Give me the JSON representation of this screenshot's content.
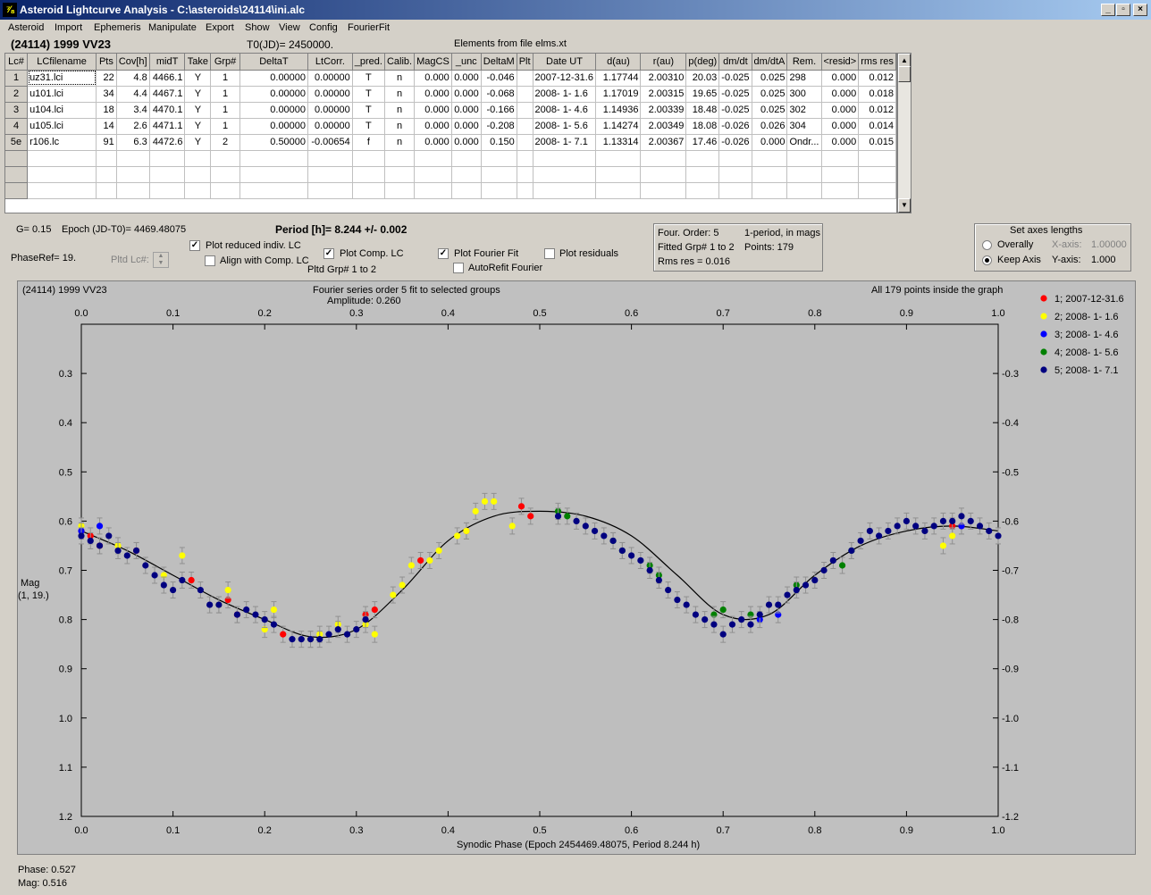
{
  "window": {
    "title": "Asteroid Lightcurve Analysis - C:\\asteroids\\24114\\ini.alc"
  },
  "menu": [
    "Asteroid",
    "Import",
    "Ephemeris",
    "Manipulate",
    "Export",
    "Show",
    "View",
    "Config",
    "FourierFit"
  ],
  "header": {
    "object": "(24114) 1999 VV23",
    "t0": "T0(JD)= 2450000.",
    "elements": "Elements from file elms.xt"
  },
  "table": {
    "columns": [
      "Lc#",
      "LCfilename",
      "Pts",
      "Cov[h]",
      "midT",
      "Take",
      "Grp#",
      "DeltaT",
      "LtCorr.",
      "_pred.",
      "Calib.",
      "MagCS",
      "_unc",
      "DeltaM",
      "Plt",
      "Date UT",
      "d(au)",
      "r(au)",
      "p(deg)",
      "dm/dt",
      "dm/dtA",
      "Rem.",
      "<resid>",
      "rms res"
    ],
    "rows": [
      [
        "1",
        "uz31.lci",
        "22",
        "4.8",
        "4466.1",
        "Y",
        "1",
        "0.00000",
        "0.00000",
        "T",
        "n",
        "0.000",
        "0.000",
        "-0.046",
        "",
        "2007-12-31.6",
        "1.17744",
        "2.00310",
        "20.03",
        "-0.025",
        "0.025",
        "298",
        "0.000",
        "0.012"
      ],
      [
        "2",
        "u101.lci",
        "34",
        "4.4",
        "4467.1",
        "Y",
        "1",
        "0.00000",
        "0.00000",
        "T",
        "n",
        "0.000",
        "0.000",
        "-0.068",
        "",
        "2008- 1- 1.6",
        "1.17019",
        "2.00315",
        "19.65",
        "-0.025",
        "0.025",
        "300",
        "0.000",
        "0.018"
      ],
      [
        "3",
        "u104.lci",
        "18",
        "3.4",
        "4470.1",
        "Y",
        "1",
        "0.00000",
        "0.00000",
        "T",
        "n",
        "0.000",
        "0.000",
        "-0.166",
        "",
        "2008- 1- 4.6",
        "1.14936",
        "2.00339",
        "18.48",
        "-0.025",
        "0.025",
        "302",
        "0.000",
        "0.012"
      ],
      [
        "4",
        "u105.lci",
        "14",
        "2.6",
        "4471.1",
        "Y",
        "1",
        "0.00000",
        "0.00000",
        "T",
        "n",
        "0.000",
        "0.000",
        "-0.208",
        "",
        "2008- 1- 5.6",
        "1.14274",
        "2.00349",
        "18.08",
        "-0.026",
        "0.026",
        "304",
        "0.000",
        "0.014"
      ],
      [
        "5e",
        "r106.lc",
        "91",
        "6.3",
        "4472.6",
        "Y",
        "2",
        "0.50000",
        "-0.00654",
        "f",
        "n",
        "0.000",
        "0.000",
        "0.150",
        "",
        "2008- 1- 7.1",
        "1.13314",
        "2.00367",
        "17.46",
        "-0.026",
        "0.000",
        "Ondr...",
        "0.000",
        "0.015"
      ]
    ]
  },
  "controls": {
    "g": "G= 0.15",
    "epoch": "Epoch (JD-T0)= 4469.48075",
    "period": "Period [h]= 8.244 +/- 0.002",
    "phaseref": "PhaseRef= 19.",
    "pltd_lc": "Pltd Lc#:",
    "plot_reduced": "Plot reduced indiv. LC",
    "align_comp": "Align with Comp. LC",
    "plot_comp": "Plot Comp. LC",
    "pltd_grp": "Pltd Grp#  1   to   2",
    "plot_fourier": "Plot Fourier Fit",
    "autorefit": "AutoRefit Fourier",
    "plot_resid": "Plot residuals",
    "four_order": "Four. Order:  5",
    "one_period": "1-period, in mags",
    "fitted_grp": "Fitted Grp# 1 to 2",
    "points": "Points: 179",
    "rms_res": "Rms res     = 0.016",
    "axes_title": "Set axes lengths",
    "overally": "Overally",
    "keep_axis": "Keep Axis",
    "x_axis_lbl": "X-axis:",
    "x_axis_val": "1.00000",
    "y_axis_lbl": "Y-axis:",
    "y_axis_val": "1.000"
  },
  "plot": {
    "corner_title": "(24114) 1999 VV23",
    "fit_title": "Fourier series order 5 fit to selected groups",
    "amplitude": "Amplitude: 0.260",
    "inside": "All 179 points inside the graph",
    "ylabel": "Mag",
    "ylabel2": "(1, 19.)",
    "xlabel": "Synodic Phase (Epoch 2454469.48075, Period 8.244 h)"
  },
  "status": {
    "phase": "Phase:  0.527",
    "mag": "Mag:    0.516"
  },
  "chart_data": {
    "type": "scatter",
    "title": "Fourier series order 5 fit to selected groups",
    "xlabel": "Synodic Phase (Epoch 2454469.48075, Period 8.244 h)",
    "ylabel": "Mag",
    "xlim": [
      0.0,
      1.0
    ],
    "ylim": [
      1.2,
      0.2
    ],
    "x_ticks": [
      "0.0",
      "0.1",
      "0.2",
      "0.3",
      "0.4",
      "0.5",
      "0.6",
      "0.7",
      "0.8",
      "0.9",
      "1.0"
    ],
    "y_ticks": [
      "0.3",
      "0.4",
      "0.5",
      "0.6",
      "0.7",
      "0.8",
      "0.9",
      "1.0",
      "1.1",
      "1.2"
    ],
    "fourier_fit": {
      "x": [
        0.0,
        0.05,
        0.1,
        0.15,
        0.2,
        0.25,
        0.3,
        0.35,
        0.4,
        0.45,
        0.5,
        0.55,
        0.6,
        0.65,
        0.7,
        0.75,
        0.8,
        0.85,
        0.9,
        0.95,
        1.0
      ],
      "y": [
        0.62,
        0.66,
        0.71,
        0.76,
        0.8,
        0.835,
        0.82,
        0.74,
        0.64,
        0.59,
        0.58,
        0.59,
        0.63,
        0.71,
        0.79,
        0.79,
        0.71,
        0.65,
        0.62,
        0.61,
        0.62
      ]
    },
    "series": [
      {
        "name": "1; 2007-12-31.6",
        "color": "#ff0000",
        "x": [
          0.0,
          0.01,
          0.02,
          0.06,
          0.12,
          0.16,
          0.17,
          0.22,
          0.31,
          0.32,
          0.37,
          0.42,
          0.48,
          0.49,
          0.95,
          0.96
        ],
        "y": [
          0.62,
          0.63,
          0.65,
          0.66,
          0.72,
          0.76,
          0.79,
          0.83,
          0.79,
          0.78,
          0.68,
          0.62,
          0.57,
          0.59,
          0.61,
          0.61
        ]
      },
      {
        "name": "2; 2008- 1- 1.6",
        "color": "#ffff00",
        "x": [
          0.0,
          0.04,
          0.09,
          0.11,
          0.15,
          0.16,
          0.2,
          0.21,
          0.25,
          0.26,
          0.28,
          0.31,
          0.32,
          0.34,
          0.35,
          0.36,
          0.38,
          0.39,
          0.41,
          0.42,
          0.43,
          0.44,
          0.45,
          0.47,
          0.94,
          0.95
        ],
        "y": [
          0.61,
          0.65,
          0.71,
          0.67,
          0.77,
          0.74,
          0.82,
          0.78,
          0.84,
          0.83,
          0.81,
          0.81,
          0.83,
          0.75,
          0.73,
          0.69,
          0.68,
          0.66,
          0.63,
          0.62,
          0.58,
          0.56,
          0.56,
          0.61,
          0.65,
          0.63
        ]
      },
      {
        "name": "3; 2008- 1- 4.6",
        "color": "#0000ff",
        "x": [
          0.0,
          0.02,
          0.74,
          0.76,
          0.96
        ],
        "y": [
          0.62,
          0.61,
          0.8,
          0.79,
          0.61
        ]
      },
      {
        "name": "4; 2008- 1- 5.6",
        "color": "#008000",
        "x": [
          0.52,
          0.53,
          0.58,
          0.59,
          0.62,
          0.63,
          0.69,
          0.7,
          0.73,
          0.78,
          0.83,
          0.84
        ],
        "y": [
          0.58,
          0.59,
          0.64,
          0.66,
          0.69,
          0.71,
          0.79,
          0.78,
          0.79,
          0.73,
          0.69,
          0.66
        ]
      },
      {
        "name": "5; 2008- 1- 7.1",
        "color": "#000080",
        "x": [
          0.0,
          0.01,
          0.02,
          0.03,
          0.04,
          0.05,
          0.06,
          0.07,
          0.08,
          0.09,
          0.1,
          0.11,
          0.13,
          0.14,
          0.15,
          0.17,
          0.18,
          0.19,
          0.2,
          0.21,
          0.23,
          0.24,
          0.25,
          0.26,
          0.27,
          0.28,
          0.29,
          0.3,
          0.31,
          0.52,
          0.54,
          0.55,
          0.56,
          0.57,
          0.58,
          0.59,
          0.6,
          0.61,
          0.62,
          0.63,
          0.64,
          0.65,
          0.66,
          0.67,
          0.68,
          0.69,
          0.7,
          0.71,
          0.72,
          0.73,
          0.74,
          0.75,
          0.76,
          0.77,
          0.78,
          0.79,
          0.8,
          0.81,
          0.82,
          0.84,
          0.85,
          0.86,
          0.87,
          0.88,
          0.89,
          0.9,
          0.91,
          0.92,
          0.93,
          0.94,
          0.95,
          0.96,
          0.97,
          0.98,
          0.99,
          1.0
        ],
        "y": [
          0.63,
          0.64,
          0.65,
          0.63,
          0.66,
          0.67,
          0.66,
          0.69,
          0.71,
          0.73,
          0.74,
          0.72,
          0.74,
          0.77,
          0.77,
          0.79,
          0.78,
          0.79,
          0.8,
          0.81,
          0.84,
          0.84,
          0.84,
          0.84,
          0.83,
          0.82,
          0.83,
          0.82,
          0.8,
          0.59,
          0.6,
          0.61,
          0.62,
          0.63,
          0.64,
          0.66,
          0.67,
          0.68,
          0.7,
          0.72,
          0.74,
          0.76,
          0.77,
          0.79,
          0.8,
          0.81,
          0.83,
          0.81,
          0.8,
          0.81,
          0.79,
          0.77,
          0.77,
          0.75,
          0.74,
          0.73,
          0.72,
          0.7,
          0.68,
          0.66,
          0.64,
          0.62,
          0.63,
          0.62,
          0.61,
          0.6,
          0.61,
          0.62,
          0.61,
          0.6,
          0.6,
          0.59,
          0.6,
          0.61,
          0.62,
          0.63
        ]
      }
    ]
  }
}
